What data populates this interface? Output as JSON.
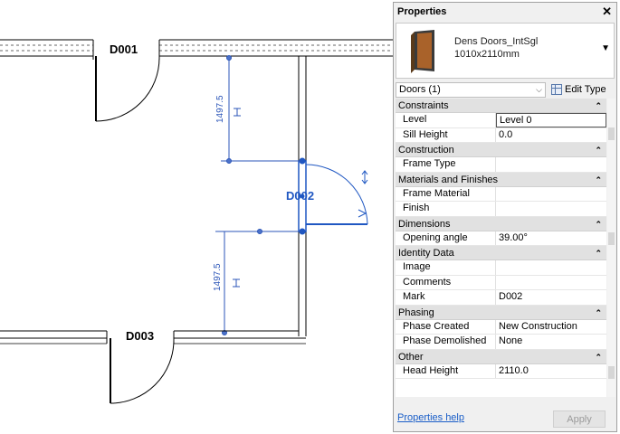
{
  "drawing": {
    "tags": {
      "d001": "D001",
      "d002": "D002",
      "d003": "D003"
    },
    "dimensions": {
      "upper": "1497.5",
      "lower": "1497.5"
    }
  },
  "panel": {
    "title": "Properties",
    "close_glyph": "✕",
    "type": {
      "name": "Dens Doors_IntSgl",
      "size": "1010x2110mm",
      "dropdown_glyph": "▼"
    },
    "filter": {
      "value": "Doors (1)",
      "arrow": "⌵"
    },
    "edit_type_label": "Edit Type",
    "groups": [
      {
        "label": "Constraints",
        "rows": [
          {
            "name": "Level",
            "value": "Level 0"
          },
          {
            "name": "Sill Height",
            "value": "0.0"
          }
        ]
      },
      {
        "label": "Construction",
        "rows": [
          {
            "name": "Frame Type",
            "value": ""
          }
        ]
      },
      {
        "label": "Materials and Finishes",
        "rows": [
          {
            "name": "Frame Material",
            "value": ""
          },
          {
            "name": "Finish",
            "value": ""
          }
        ]
      },
      {
        "label": "Dimensions",
        "rows": [
          {
            "name": "Opening angle",
            "value": "39.00°"
          }
        ]
      },
      {
        "label": "Identity Data",
        "rows": [
          {
            "name": "Image",
            "value": ""
          },
          {
            "name": "Comments",
            "value": ""
          },
          {
            "name": "Mark",
            "value": "D002"
          }
        ]
      },
      {
        "label": "Phasing",
        "rows": [
          {
            "name": "Phase Created",
            "value": "New Construction"
          },
          {
            "name": "Phase Demolished",
            "value": "None"
          }
        ]
      },
      {
        "label": "Other",
        "rows": [
          {
            "name": "Head Height",
            "value": "2110.0"
          }
        ]
      }
    ],
    "collapse_glyph": "⌃",
    "help_link": "Properties help",
    "apply_label": "Apply"
  },
  "colors": {
    "selection": "#1f57c2",
    "link": "#1a5ec8"
  }
}
